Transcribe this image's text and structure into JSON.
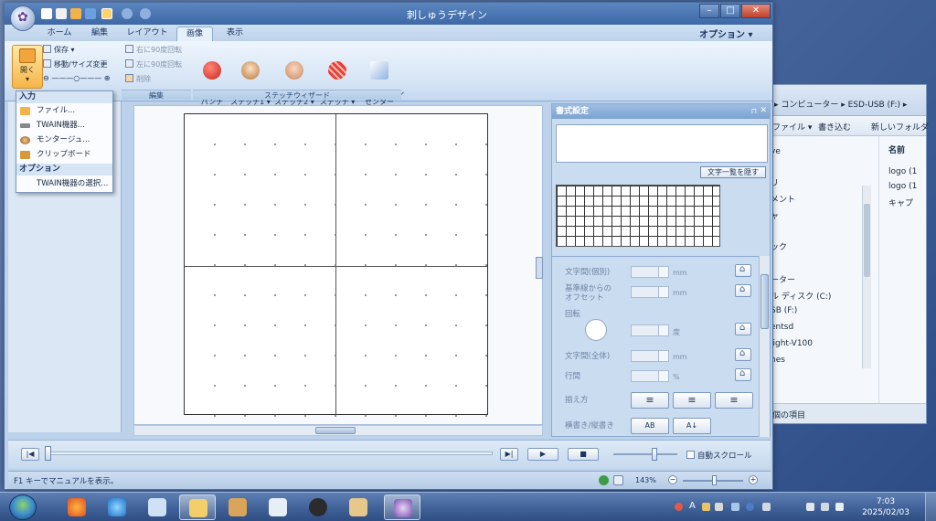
{
  "explorer": {
    "breadcrumb": "▸ コンピューター ▸ ESD-USB (F:) ▸",
    "toolbar": {
      "organize": "ファイル ▾",
      "write": "書き込む",
      "new_folder": "新しいフォルダ"
    },
    "column_name": "名前",
    "nav_items": [
      "ve",
      "リ",
      "メント",
      "ャ",
      "ック",
      "ーター",
      "ル ディスク (C:)",
      "SB (F:)",
      "entsd",
      "light-V100",
      "hes"
    ],
    "files": [
      "logo (1",
      "logo (1",
      "キャプ"
    ],
    "status": "個の項目"
  },
  "app": {
    "window_title": "刺しゅうデザイン",
    "tabs": [
      "ホーム",
      "編集",
      "レイアウト",
      "画像",
      "表示"
    ],
    "active_tab": "画像",
    "options_label": "オプション ▾",
    "ribbon": {
      "open_label": "開く",
      "save_label": "保存 ▾",
      "move_resize_label": "移動/サイズ変更",
      "rotate_right_label": "右に90度回転",
      "rotate_left_label": "左に90度回転",
      "delete_label": "削除",
      "edit_group": "編集",
      "auto_punch": "オート\nパンチ",
      "photo1": "フォト\nステッチ1 ▾",
      "photo2": "フォト\nステッチ2 ▾",
      "cross": "クロス\nステッチ ▾",
      "design_center": "デザイン\nセンター",
      "wizard_group": "ステッチウィザード"
    },
    "dropdown": {
      "input_header": "入力",
      "file": "ファイル...",
      "twain": "TWAIN機器...",
      "montage": "モンタージュ...",
      "clipboard": "クリップボード",
      "options_header": "オプション",
      "twain_select": "TWAIN機器の選択..."
    },
    "format_panel": {
      "title": "書式設定",
      "hide_list": "文字一覧を隠す",
      "char_spacing_partial": "文字間(個別)",
      "baseline_offset": "基準線からの\nオフセット",
      "rotation": "回転",
      "char_spacing_all": "文字間(全体)",
      "line_spacing": "行間",
      "alignment": "揃え方",
      "orientation": "横書き/縦書き",
      "unit_mm": "mm",
      "unit_deg": "度",
      "unit_pct": "%",
      "align_icons": [
        "≡",
        "≡",
        "≡"
      ],
      "orient_icons": [
        "AB",
        "A↓"
      ]
    },
    "playback": {
      "autoscroll": "自動スクロール",
      "progress": 0.0,
      "speed": 0.6
    },
    "status": {
      "help_text": "F1 キーでマニュアルを表示。",
      "zoom": "143%",
      "zoom_level": 0.5
    }
  },
  "taskbar": {
    "lang": "A",
    "time": "7:03",
    "date": "2025/02/03"
  },
  "colors": {
    "accent": "#3d68a6",
    "ribbon_bg": "#d5e4f5",
    "open_highlight": "#f5b548"
  }
}
